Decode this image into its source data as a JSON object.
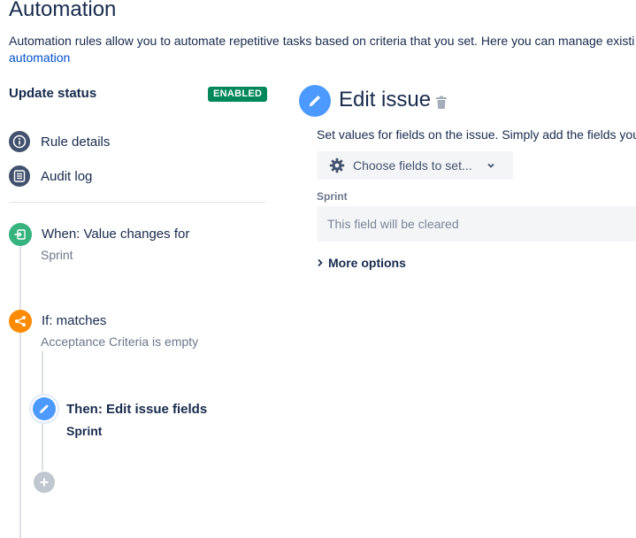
{
  "page": {
    "title": "Automation",
    "description": "Automation rules allow you to automate repetitive tasks based on criteria that you set. Here you can manage existi",
    "link": "automation"
  },
  "rule": {
    "name": "Update status",
    "status_badge": "ENABLED"
  },
  "nav": {
    "rule_details": "Rule details",
    "audit_log": "Audit log"
  },
  "steps": {
    "trigger": {
      "title": "When: Value changes for",
      "subtitle": "Sprint",
      "color": "#36b37e",
      "icon": "trigger-icon"
    },
    "condition": {
      "title": "If: matches",
      "subtitle": "Acceptance Criteria is empty",
      "color": "#ff8b00",
      "icon": "branch-icon"
    },
    "action": {
      "title": "Then: Edit issue fields",
      "subtitle": "Sprint",
      "color": "#4c9aff",
      "icon": "pencil-icon"
    },
    "add": {
      "icon": "plus-icon"
    }
  },
  "editor": {
    "title": "Edit issue",
    "description": "Set values for fields on the issue. Simply add the fields you",
    "choose_fields_label": "Choose fields to set...",
    "field_label": "Sprint",
    "field_placeholder": "This field will be cleared",
    "more_options": "More options"
  },
  "colors": {
    "accent": "#0052cc",
    "enabled": "#00875a",
    "nav_icon": "#42526e"
  }
}
